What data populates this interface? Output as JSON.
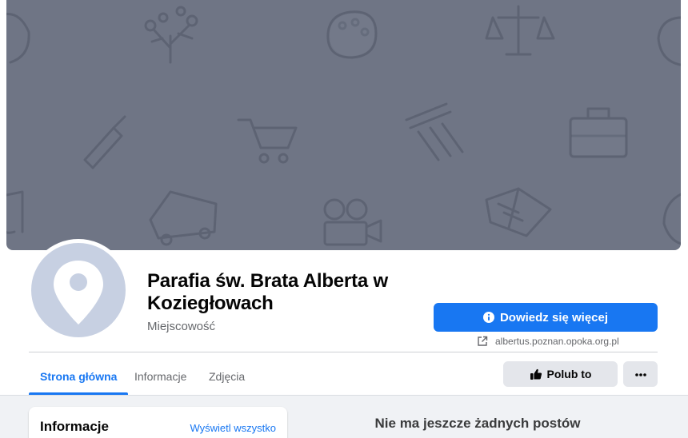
{
  "page": {
    "title": "Parafia św. Brata Alberta w Koziegłowach",
    "category": "Miejscowość"
  },
  "actions": {
    "cta_label": "Dowiedz się więcej",
    "website": "albertus.poznan.opoka.org.pl",
    "like_label": "Polub to",
    "more_label": "..."
  },
  "tabs": [
    {
      "label": "Strona główna",
      "active": true
    },
    {
      "label": "Informacje",
      "active": false
    },
    {
      "label": "Zdjęcia",
      "active": false
    }
  ],
  "info_card": {
    "title": "Informacje",
    "see_all": "Wyświetl wszystko"
  },
  "feed": {
    "empty_message": "Nie ma jeszcze żadnych postów"
  },
  "colors": {
    "accent": "#1877f2",
    "cover": "#6f7585",
    "avatar": "#c7d0e2"
  },
  "icons": {
    "cta": "info-circle-icon",
    "website": "external-link-icon",
    "like": "thumbs-up-icon",
    "more": "more-dots-icon",
    "avatar": "location-pin-icon"
  }
}
